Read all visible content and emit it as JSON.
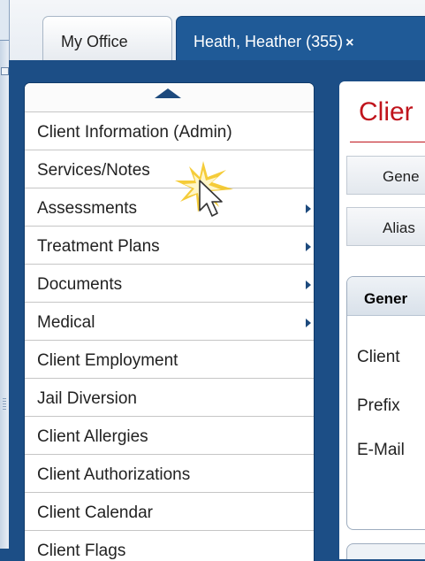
{
  "tabs": [
    {
      "label": "My Office",
      "close": ""
    },
    {
      "label": "Heath, Heather (355)",
      "close": "×"
    }
  ],
  "menu": {
    "scroll_icon": "up-arrow-icon",
    "items": [
      {
        "label": "Client Information (Admin)",
        "submenu": false
      },
      {
        "label": "Services/Notes",
        "submenu": false
      },
      {
        "label": "Assessments",
        "submenu": true
      },
      {
        "label": "Treatment Plans",
        "submenu": true
      },
      {
        "label": "Documents",
        "submenu": true
      },
      {
        "label": "Medical",
        "submenu": true
      },
      {
        "label": "Client Employment",
        "submenu": false
      },
      {
        "label": "Jail Diversion",
        "submenu": false
      },
      {
        "label": "Client Allergies",
        "submenu": false
      },
      {
        "label": "Client Authorizations",
        "submenu": false
      },
      {
        "label": "Client Calendar",
        "submenu": false
      },
      {
        "label": "Client Flags",
        "submenu": false
      }
    ]
  },
  "content": {
    "title": "Clier",
    "subtabs": [
      "Gene",
      "Alias"
    ],
    "panel_title": "Gener",
    "fields": [
      "Client",
      "Prefix",
      "E-Mail"
    ]
  },
  "colors": {
    "accent_blue": "#1c4e86",
    "title_red": "#c0141c",
    "highlight_star": "#f3c316"
  }
}
